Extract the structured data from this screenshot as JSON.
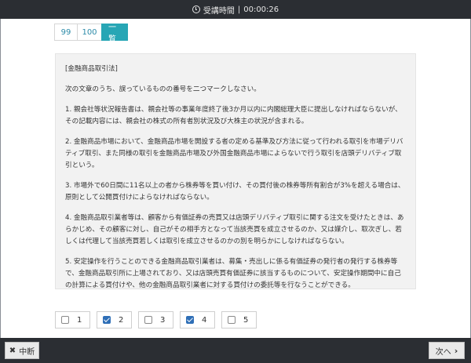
{
  "header": {
    "timer_label": "受講時間",
    "separator": "|",
    "elapsed": "00:00:26"
  },
  "tabs": [
    {
      "label": "99",
      "active": false
    },
    {
      "label": "100",
      "active": false
    },
    {
      "label": "一覧",
      "active": true
    }
  ],
  "question": {
    "category": "[金融商品取引法]",
    "instruction": "次の文章のうち、誤っているものの番号を二つマークしなさい。",
    "items": [
      "1. 親会社等状況報告書は、親会社等の事業年度終了後3か月以内に内閣総理大臣に提出しなければならないが、その記載内容には、親会社の株式の所有者別状況及び大株主の状況が含まれる。",
      "2. 金融商品市場において、金融商品市場を開設する者の定める基準及び方法に従って行われる取引を市場デリバティブ取引、また同様の取引を金融商品市場及び外国金融商品市場によらないで行う取引を店頭デリバティブ取引という。",
      "3. 市場外で60日間に11名以上の者から株券等を買い付け、その買付後の株券等所有割合が3%を超える場合は、原則として公開買付けによらなければならない。",
      "4. 金融商品取引業者等は、顧客から有価証券の売買又は店頭デリバティブ取引に関する注文を受けたときは、あらかじめ、その顧客に対し、自己がその相手方となって当該売買を成立させるのか、又は媒介し、取次ぎし、若しくは代理して当該売買若しくは取引を成立させるのかの別を明らかにしなければならない。",
      "5. 安定操作を行うことのできる金融商品取引業者は、募集・売出しに係る有価証券の発行者の発行する株券等で、金融商品取引所に上場されており、又は店頭売買有価証券に該当するものについて、安定操作期間中に自己の計算による買付けや、他の金融商品取引業者に対する買付けの委託等を行なうことができる。"
    ]
  },
  "answers": [
    {
      "label": "1",
      "checked": false
    },
    {
      "label": "2",
      "checked": true
    },
    {
      "label": "3",
      "checked": false
    },
    {
      "label": "4",
      "checked": true
    },
    {
      "label": "5",
      "checked": false
    }
  ],
  "footer": {
    "suspend_label": "中断",
    "next_label": "次へ"
  }
}
